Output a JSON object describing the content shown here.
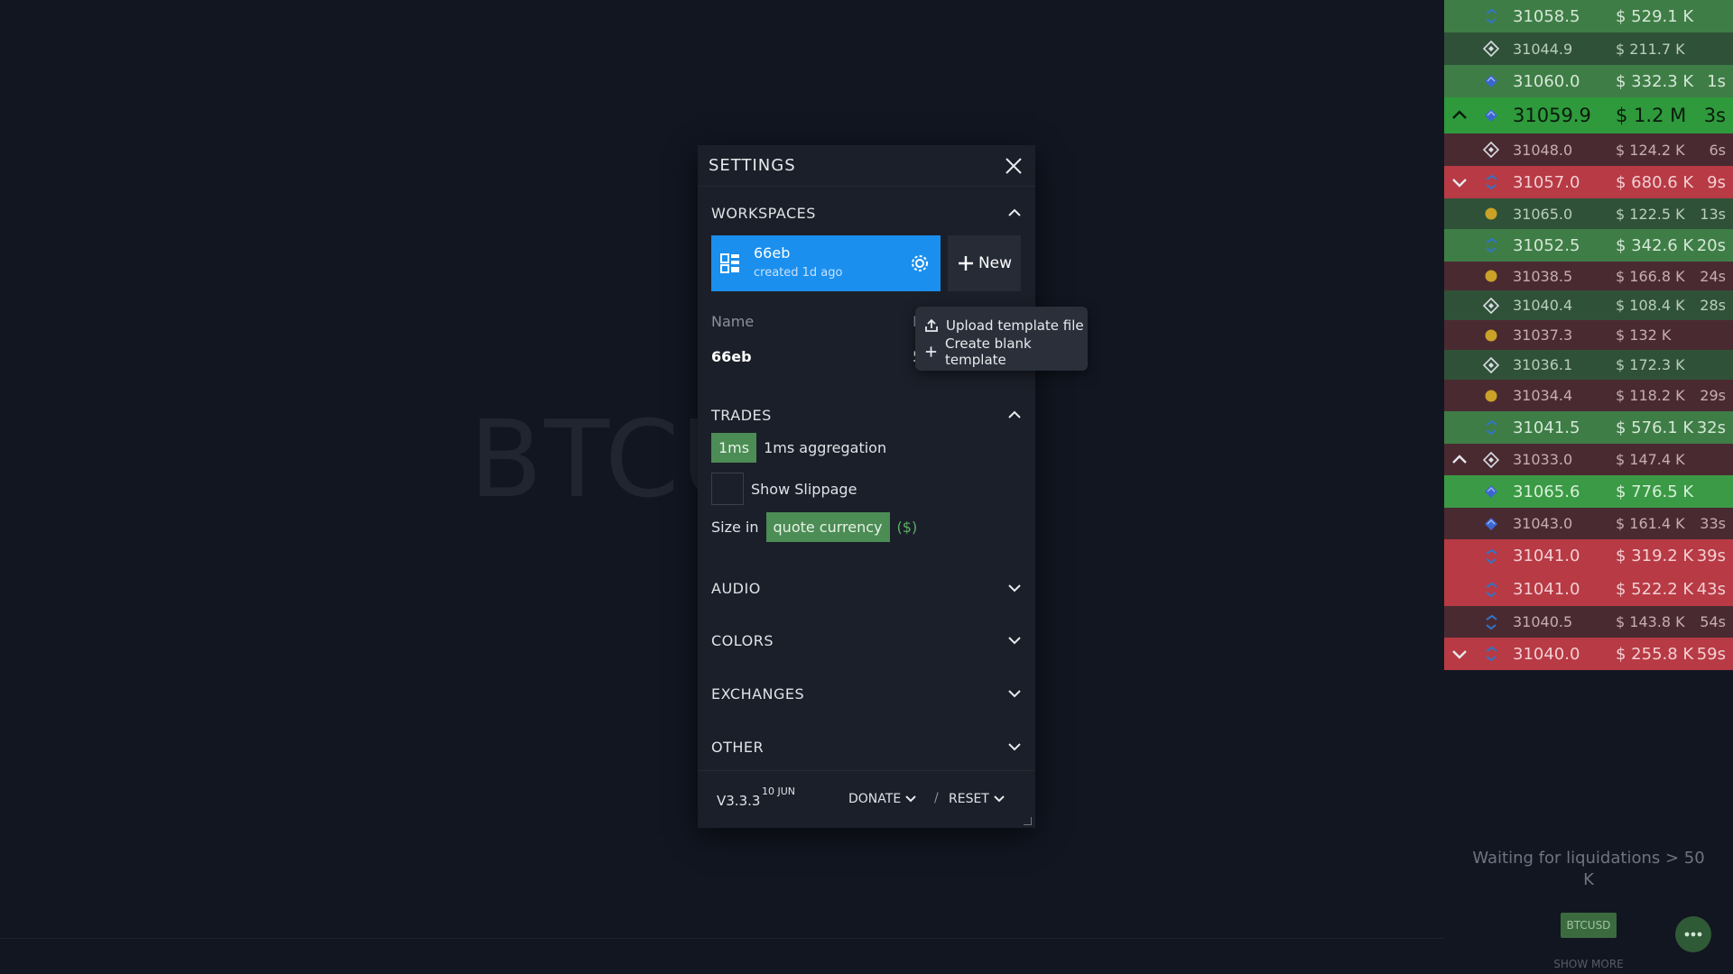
{
  "background": {
    "ticker": "BTCUS"
  },
  "settings": {
    "title": "SETTINGS",
    "workspaces": {
      "title": "WORKSPACES",
      "current": {
        "name": "66eb",
        "created": "created 1d ago"
      },
      "new_label": "New",
      "name_label": "Name",
      "name_value": "66eb",
      "partial_col_label": "L",
      "partial_col_value": "5"
    },
    "menu": {
      "upload": "Upload template file",
      "blank": "Create blank template"
    },
    "trades": {
      "title": "TRADES",
      "aggregation_pill": "1ms",
      "aggregation_label": "1ms aggregation",
      "slippage_label": "Show Slippage",
      "size_in_label": "Size in",
      "size_in_value": "quote currency",
      "currency_symbol": "($)"
    },
    "sections": {
      "audio": "AUDIO",
      "colors": "COLORS",
      "exchanges": "EXCHANGES",
      "other": "OTHER"
    },
    "footer": {
      "version": "V3.3.3",
      "date": "10 JUN",
      "donate": "DONATE",
      "separator": "/",
      "reset": "RESET"
    }
  },
  "trades_feed": {
    "rows": [
      {
        "price": "31058.5",
        "amount": "$ 529.1 K",
        "time": "",
        "side": "buy",
        "icon": "coinbase-icon",
        "arrow": ""
      },
      {
        "price": "31044.9",
        "amount": "$ 211.7 K",
        "time": "",
        "side": "buy-light",
        "icon": "binance-icon",
        "arrow": ""
      },
      {
        "price": "31060.0",
        "amount": "$ 332.3 K",
        "time": "1s",
        "side": "buy",
        "icon": "kraken-icon",
        "arrow": ""
      },
      {
        "price": "31059.9",
        "amount": "$ 1.2 M",
        "time": "3s",
        "side": "buy-strong",
        "icon": "kraken-icon",
        "arrow": "up"
      },
      {
        "price": "31048.0",
        "amount": "$ 124.2 K",
        "time": "6s",
        "side": "sell-light",
        "icon": "binance-icon",
        "arrow": ""
      },
      {
        "price": "31057.0",
        "amount": "$ 680.6 K",
        "time": "9s",
        "side": "sell",
        "icon": "coinbase-icon",
        "arrow": "down"
      },
      {
        "price": "31065.0",
        "amount": "$ 122.5 K",
        "time": "13s",
        "side": "buy-light",
        "icon": "bitfinex-icon",
        "arrow": ""
      },
      {
        "price": "31052.5",
        "amount": "$ 342.6 K",
        "time": "20s",
        "side": "buy",
        "icon": "coinbase-icon",
        "arrow": ""
      },
      {
        "price": "31038.5",
        "amount": "$ 166.8 K",
        "time": "24s",
        "side": "sell-light",
        "icon": "bitfinex-icon",
        "arrow": ""
      },
      {
        "price": "31040.4",
        "amount": "$ 108.4 K",
        "time": "28s",
        "side": "buy-light",
        "icon": "binance-icon",
        "arrow": ""
      },
      {
        "price": "31037.3",
        "amount": "$ 132 K",
        "time": "",
        "side": "sell-light",
        "icon": "bitfinex-icon",
        "arrow": ""
      },
      {
        "price": "31036.1",
        "amount": "$ 172.3 K",
        "time": "",
        "side": "buy-light",
        "icon": "binance-icon",
        "arrow": ""
      },
      {
        "price": "31034.4",
        "amount": "$ 118.2 K",
        "time": "29s",
        "side": "sell-light",
        "icon": "bitfinex-icon",
        "arrow": ""
      },
      {
        "price": "31041.5",
        "amount": "$ 576.1 K",
        "time": "32s",
        "side": "buy",
        "icon": "coinbase-icon",
        "arrow": ""
      },
      {
        "price": "31033.0",
        "amount": "$ 147.4 K",
        "time": "",
        "side": "sell-light",
        "icon": "binance-icon",
        "arrow": "up"
      },
      {
        "price": "31065.6",
        "amount": "$ 776.5 K",
        "time": "",
        "side": "buy-bright",
        "icon": "kraken-icon",
        "arrow": ""
      },
      {
        "price": "31043.0",
        "amount": "$ 161.4 K",
        "time": "33s",
        "side": "sell-light",
        "icon": "kraken-icon",
        "arrow": ""
      },
      {
        "price": "31041.0",
        "amount": "$ 319.2 K",
        "time": "39s",
        "side": "sell",
        "icon": "coinbase-icon",
        "arrow": ""
      },
      {
        "price": "31041.0",
        "amount": "$ 522.2 K",
        "time": "43s",
        "side": "sell",
        "icon": "coinbase-icon",
        "arrow": ""
      },
      {
        "price": "31040.5",
        "amount": "$ 143.8 K",
        "time": "54s",
        "side": "sell-light",
        "icon": "coinbase-icon",
        "arrow": ""
      },
      {
        "price": "31040.0",
        "amount": "$ 255.8 K",
        "time": "59s",
        "side": "sell",
        "icon": "coinbase-icon",
        "arrow": "down"
      }
    ],
    "waiting_text": "Waiting for liquidations > 50 K",
    "pair_badge": "BTCUSD",
    "show_more": "SHOW MORE"
  },
  "colors": {
    "accent_blue": "#1a8fee",
    "buy": "#3f8a46",
    "sell": "#b73a44",
    "pill_green": "#4c8c55"
  }
}
